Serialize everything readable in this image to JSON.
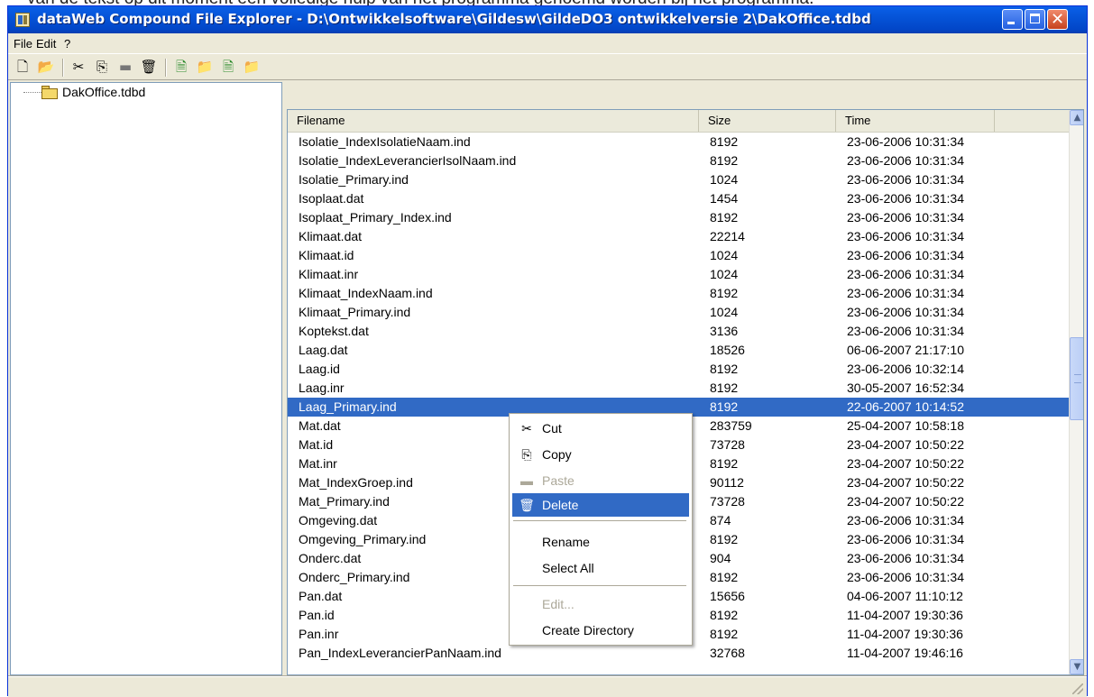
{
  "page_caption": "van de tekst op dit moment een volledige hulp van het programma genoemd worden bij het programma.",
  "window": {
    "title": "dataWeb Compound File Explorer - D:\\Ontwikkelsoftware\\Gildesw\\GildeDO3 ontwikkelversie 2\\DakOffice.tdbd"
  },
  "menu": [
    "File",
    "Edit",
    "?"
  ],
  "toolbar_icons": [
    "new-file-icon",
    "open-folder-icon",
    "cut-icon",
    "copy-icon",
    "paste-icon",
    "delete-icon",
    "add-file-icon",
    "add-folder-icon",
    "extract-file-icon",
    "extract-folder-icon"
  ],
  "tree": {
    "root_label": "DakOffice.tdbd"
  },
  "list": {
    "columns": [
      "Filename",
      "Size",
      "Time"
    ],
    "rows": [
      {
        "name": "Isolatie_IndexIsolatieNaam.ind",
        "size": "8192",
        "time": "23-06-2006 10:31:34"
      },
      {
        "name": "Isolatie_IndexLeverancierIsolNaam.ind",
        "size": "8192",
        "time": "23-06-2006 10:31:34"
      },
      {
        "name": "Isolatie_Primary.ind",
        "size": "1024",
        "time": "23-06-2006 10:31:34"
      },
      {
        "name": "Isoplaat.dat",
        "size": "1454",
        "time": "23-06-2006 10:31:34"
      },
      {
        "name": "Isoplaat_Primary_Index.ind",
        "size": "8192",
        "time": "23-06-2006 10:31:34"
      },
      {
        "name": "Klimaat.dat",
        "size": "22214",
        "time": "23-06-2006 10:31:34"
      },
      {
        "name": "Klimaat.id",
        "size": "1024",
        "time": "23-06-2006 10:31:34"
      },
      {
        "name": "Klimaat.inr",
        "size": "1024",
        "time": "23-06-2006 10:31:34"
      },
      {
        "name": "Klimaat_IndexNaam.ind",
        "size": "8192",
        "time": "23-06-2006 10:31:34"
      },
      {
        "name": "Klimaat_Primary.ind",
        "size": "1024",
        "time": "23-06-2006 10:31:34"
      },
      {
        "name": "Koptekst.dat",
        "size": "3136",
        "time": "23-06-2006 10:31:34"
      },
      {
        "name": "Laag.dat",
        "size": "18526",
        "time": "06-06-2007 21:17:10"
      },
      {
        "name": "Laag.id",
        "size": "8192",
        "time": "23-06-2006 10:32:14"
      },
      {
        "name": "Laag.inr",
        "size": "8192",
        "time": "30-05-2007 16:52:34"
      },
      {
        "name": "Laag_Primary.ind",
        "size": "8192",
        "time": "22-06-2007 10:14:52",
        "selected": true
      },
      {
        "name": "Mat.dat",
        "size": "283759",
        "time": "25-04-2007 10:58:18"
      },
      {
        "name": "Mat.id",
        "size": "73728",
        "time": "23-04-2007 10:50:22"
      },
      {
        "name": "Mat.inr",
        "size": "8192",
        "time": "23-04-2007 10:50:22"
      },
      {
        "name": "Mat_IndexGroep.ind",
        "size": "90112",
        "time": "23-04-2007 10:50:22"
      },
      {
        "name": "Mat_Primary.ind",
        "size": "73728",
        "time": "23-04-2007 10:50:22"
      },
      {
        "name": "Omgeving.dat",
        "size": "874",
        "time": "23-06-2006 10:31:34"
      },
      {
        "name": "Omgeving_Primary.ind",
        "size": "8192",
        "time": "23-06-2006 10:31:34"
      },
      {
        "name": "Onderc.dat",
        "size": "904",
        "time": "23-06-2006 10:31:34"
      },
      {
        "name": "Onderc_Primary.ind",
        "size": "8192",
        "time": "23-06-2006 10:31:34"
      },
      {
        "name": "Pan.dat",
        "size": "15656",
        "time": "04-06-2007 11:10:12"
      },
      {
        "name": "Pan.id",
        "size": "8192",
        "time": "11-04-2007 19:30:36"
      },
      {
        "name": "Pan.inr",
        "size": "8192",
        "time": "11-04-2007 19:30:36"
      },
      {
        "name": "Pan_IndexLeverancierPanNaam.ind",
        "size": "32768",
        "time": "11-04-2007 19:46:16"
      }
    ]
  },
  "context_menu": {
    "items": [
      {
        "label": "Cut",
        "icon": "scissors-icon",
        "enabled": true
      },
      {
        "label": "Copy",
        "icon": "copy-icon",
        "enabled": true
      },
      {
        "label": "Paste",
        "icon": "paste-icon",
        "enabled": false
      },
      {
        "label": "Delete",
        "icon": "trash-icon",
        "enabled": true,
        "highlighted": true
      },
      {
        "label": "Rename",
        "enabled": true
      },
      {
        "label": "Select All",
        "enabled": true
      },
      {
        "label": "Edit...",
        "enabled": false
      },
      {
        "label": "Create Directory",
        "enabled": true
      }
    ]
  },
  "colors": {
    "selection": "#316ac5",
    "titlebar": "#0554d8",
    "window_bg": "#ece9d8"
  }
}
